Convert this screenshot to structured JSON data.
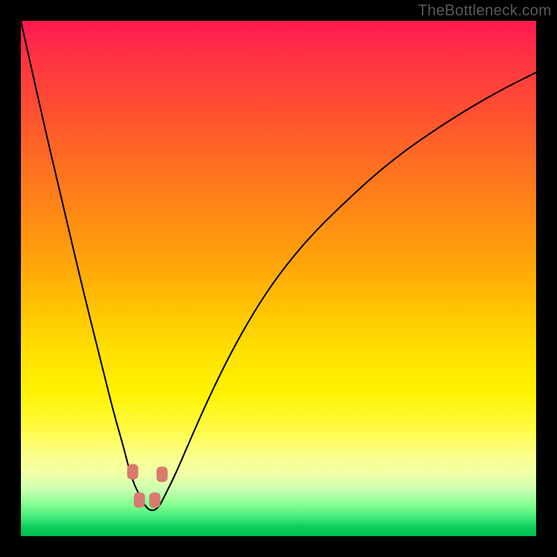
{
  "watermark": "TheBottleneck.com",
  "chart_data": {
    "type": "line",
    "title": "",
    "xlabel": "",
    "ylabel": "",
    "xlim": [
      0,
      100
    ],
    "ylim": [
      0,
      100
    ],
    "x": [
      0,
      4,
      8,
      12,
      16,
      18,
      20,
      21,
      22,
      23,
      24,
      25,
      26,
      27,
      28,
      30,
      33,
      37,
      42,
      48,
      55,
      63,
      72,
      82,
      92,
      100
    ],
    "y": [
      100,
      82,
      65,
      48,
      32,
      24,
      17,
      13,
      10,
      8,
      6,
      5,
      5,
      6,
      8,
      12,
      19,
      28,
      38,
      48,
      57,
      65,
      73,
      80,
      86,
      90
    ],
    "dip_x": 24.5,
    "markers": [
      {
        "x": 21.7,
        "y": 12.5
      },
      {
        "x": 23.0,
        "y": 7.0
      },
      {
        "x": 26.0,
        "y": 7.0
      },
      {
        "x": 27.4,
        "y": 12.0
      }
    ],
    "background_gradient": {
      "top": "#ff1850",
      "mid_upper": "#ff8a14",
      "mid": "#ffe000",
      "mid_lower": "#fcff88",
      "bottom": "#00c050"
    }
  }
}
